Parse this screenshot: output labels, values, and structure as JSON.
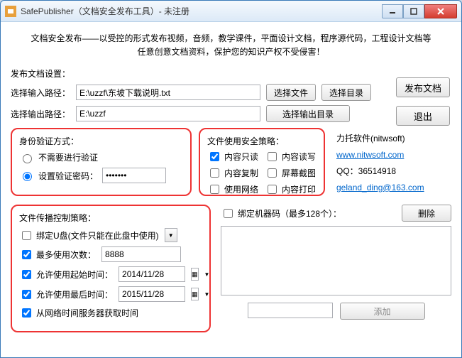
{
  "window": {
    "title": "SafePublisher（文档安全发布工具）- 未注册"
  },
  "intro": {
    "line1": "文档安全发布——以受控的形式发布视频，音频，教学课件，平面设计文档，程序源代码，工程设计文档等",
    "line2": "任意创意文档资料，保护您的知识产权不受侵害！"
  },
  "settings": {
    "header": "发布文档设置：",
    "input_label": "选择输入路径：",
    "input_value": "E:\\uzzf\\东坡下载说明.txt",
    "output_label": "选择输出路径：",
    "output_value": "E:\\uzzf",
    "select_file": "选择文件",
    "select_dir": "选择目录",
    "select_out_dir": "选择输出目录",
    "publish": "发布文档",
    "exit": "退出"
  },
  "auth": {
    "title": "身份验证方式：",
    "no_auth": "不需要进行验证",
    "set_pwd": "设置验证密码：",
    "pwd_value": "•••••••"
  },
  "policy": {
    "title": "文件使用安全策略：",
    "readonly": "内容只读",
    "readwrite": "内容读写",
    "copy": "内容复制",
    "screenshot": "屏幕截图",
    "network": "使用网络",
    "print": "内容打印"
  },
  "vendor": {
    "company": "力托软件(nitwsoft)",
    "url": "www.nitwsoft.com",
    "qq_label": "QQ：",
    "qq": "36514918",
    "email": "geland_ding@163.com"
  },
  "prop": {
    "title": "文件传播控制策略：",
    "usb": "绑定U盘(文件只能在此盘中使用)",
    "max_use": "最多使用次数：",
    "max_use_val": "8888",
    "start_time": "允许使用起始时间：",
    "start_val": "2014/11/28",
    "end_time": "允许使用最后时间：",
    "end_val": "2015/11/28",
    "net_time": "从网络时间服务器获取时间"
  },
  "machine": {
    "bind": "绑定机器码（最多128个）：",
    "delete": "删除",
    "add": "添加"
  }
}
